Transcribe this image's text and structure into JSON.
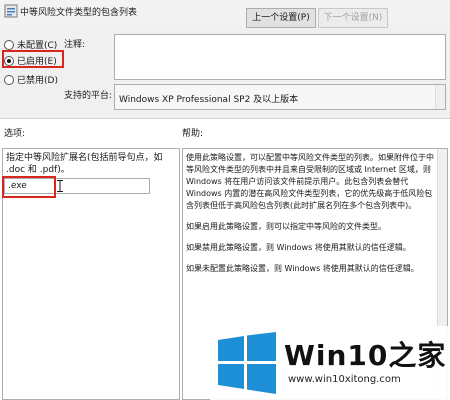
{
  "header": {
    "title": "中等风险文件类型的包含列表",
    "prev_button": "上一个设置(P)",
    "next_button": "下一个设置(N)"
  },
  "radios": [
    {
      "label": "未配置(C)",
      "checked": false
    },
    {
      "label": "已启用(E)",
      "checked": true
    },
    {
      "label": "已禁用(D)",
      "checked": false
    }
  ],
  "labels": {
    "comment": "注释:",
    "supported": "支持的平台:",
    "options": "选项:",
    "help": "帮助:"
  },
  "supported_value": "Windows XP Professional SP2 及以上版本",
  "options": {
    "description": "指定中等风险扩展名(包括前导句点，如 .doc 和 .pdf)。",
    "input_value": ".exe"
  },
  "help_paragraphs": [
    "使用此策略设置，可以配置中等风险文件类型的列表。如果附件位于中等风险文件类型的列表中并且来自受限制的区域或 Internet 区域，则 Windows 将在用户访问该文件前提示用户。此包含列表会替代 Windows 内置的潜在高风险文件类型列表，它的优先级高于低风险包含列表但低于高风险包含列表(此时扩展名列在多个包含列表中)。",
    "如果启用此策略设置，则可以指定中等风险的文件类型。",
    "如果禁用此策略设置，则 Windows 将使用其默认的信任逻辑。",
    "如果未配置此策略设置，则 Windows 将使用其默认的信任逻辑。"
  ],
  "watermark": {
    "brand": "Win10之家",
    "url": "www.win10xitong.com"
  },
  "colors": {
    "highlight_red": "#d9261c",
    "win_blue": "#1c8fd6"
  }
}
